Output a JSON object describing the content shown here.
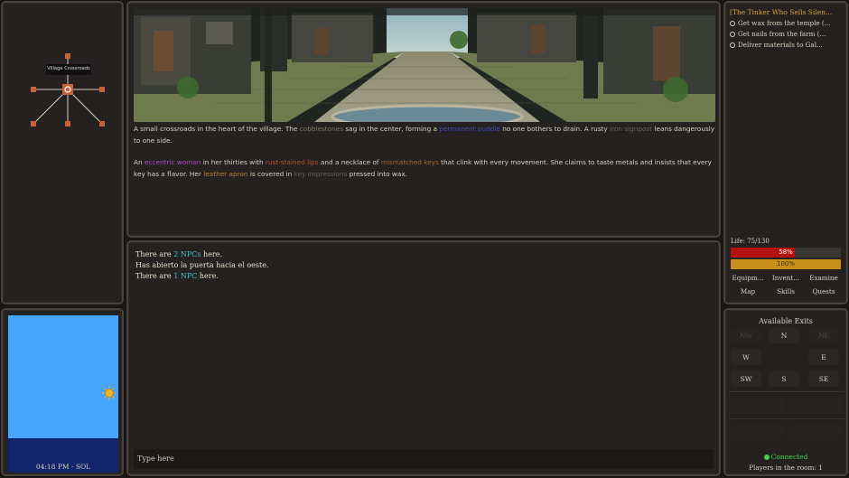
{
  "map": {
    "location_label": "Village Crossroads"
  },
  "time": {
    "clock": "04:18 PM - SOL",
    "colors": {
      "sky": "#46a6fd",
      "ground": "#12246b",
      "sun": "#f2b12b"
    }
  },
  "room": {
    "description": [
      [
        {
          "t": "A small crossroads in the heart of the village. The ",
          "c": ""
        },
        {
          "t": "cobblestones",
          "c": "#7e7566"
        },
        {
          "t": " sag in the center, forming a ",
          "c": ""
        },
        {
          "t": "permanent puddle",
          "c": "#3b49b8"
        },
        {
          "t": " no one bothers to drain. A rusty ",
          "c": ""
        },
        {
          "t": "iron signpost",
          "c": "#6b6258"
        },
        {
          "t": " leans dangerously to one side.",
          "c": ""
        }
      ],
      [
        {
          "t": "An ",
          "c": ""
        },
        {
          "t": "eccentric woman",
          "c": "#b14ac9"
        },
        {
          "t": " in her thirties with ",
          "c": ""
        },
        {
          "t": "rust-stained lips",
          "c": "#b4562c"
        },
        {
          "t": " and a necklace of ",
          "c": ""
        },
        {
          "t": "mismatched keys",
          "c": "#a2682e"
        },
        {
          "t": " that clink with every movement. She claims to taste metals and insists that every key has a flavor. Her ",
          "c": ""
        },
        {
          "t": "leather apron",
          "c": "#b48037"
        },
        {
          "t": " is covered in ",
          "c": ""
        },
        {
          "t": "key impressions",
          "c": "#6a5f54"
        },
        {
          "t": " pressed into wax.",
          "c": ""
        }
      ]
    ]
  },
  "log": {
    "lines": [
      [
        {
          "t": "There are ",
          "hi": false
        },
        {
          "t": "2 NPCs",
          "hi": true
        },
        {
          "t": " here.",
          "hi": false
        }
      ],
      [
        {
          "t": "Has abierto la puerta hacia el oeste.",
          "hi": false
        }
      ],
      [
        {
          "t": "There are ",
          "hi": false
        },
        {
          "t": "1 NPC",
          "hi": true
        },
        {
          "t": " here.",
          "hi": false
        }
      ]
    ],
    "input_placeholder": "Type here"
  },
  "quest": {
    "title": "[The Tinker Who Sells Silen...",
    "items": [
      "Get wax from the temple (...",
      "Get nails from the farm (...",
      "Deliver materials to Gal..."
    ]
  },
  "stats": {
    "life_label": "Life: 75/130",
    "life_fraction": 0.58,
    "life_text": "58%",
    "stamina_fraction": 1.0,
    "stamina_text": "100%",
    "colors": {
      "life": "#b3120e",
      "stamina": "#c8901a"
    }
  },
  "buttons": {
    "row1": [
      "Equipm...",
      "Invent...",
      "Examine"
    ],
    "row2": [
      "Map",
      "Skills",
      "Quests"
    ]
  },
  "exits": {
    "title": "Available Exits",
    "grid": [
      {
        "label": "NW",
        "on": false
      },
      {
        "label": "N",
        "on": true
      },
      {
        "label": "NE",
        "on": false
      },
      {
        "label": "W",
        "on": true
      },
      {
        "label": "",
        "on": false
      },
      {
        "label": "E",
        "on": true
      },
      {
        "label": "SW",
        "on": true
      },
      {
        "label": "S",
        "on": true
      },
      {
        "label": "SE",
        "on": true
      }
    ],
    "connected": "Connected",
    "players": "Players in the room: 1"
  }
}
